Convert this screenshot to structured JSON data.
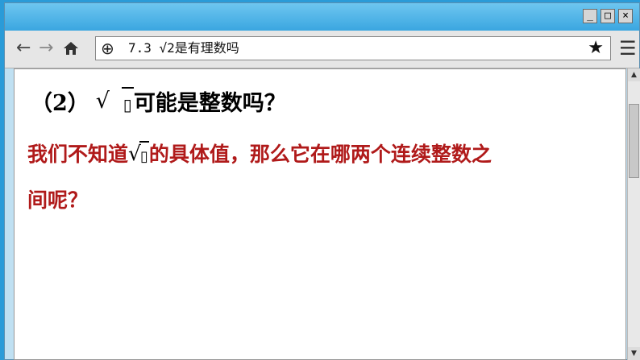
{
  "window": {
    "minimize_icon": "minimize-icon",
    "maximize_icon": "maximize-icon",
    "close_icon": "close-icon"
  },
  "toolbar": {
    "back_icon": "arrow-left-icon",
    "forward_icon": "arrow-right-icon",
    "home_icon": "home-icon",
    "url": "7.3 √2是有理数吗",
    "globe_icon": "globe-icon",
    "bookmark_icon": "star-icon",
    "menu_icon": "hamburger-menu-icon"
  },
  "content": {
    "question_prefix": "（2）",
    "question_radicand": "▯",
    "question_suffix": "可能是整数吗？",
    "line1_prefix": "我们不知道",
    "line1_radicand": "▯",
    "line1_suffix": "的具体值，那么它在哪两个连续整数之",
    "line2": "间呢？"
  },
  "colors": {
    "accent_red": "#b01a1a",
    "titlebar": "#3aa6e0"
  }
}
